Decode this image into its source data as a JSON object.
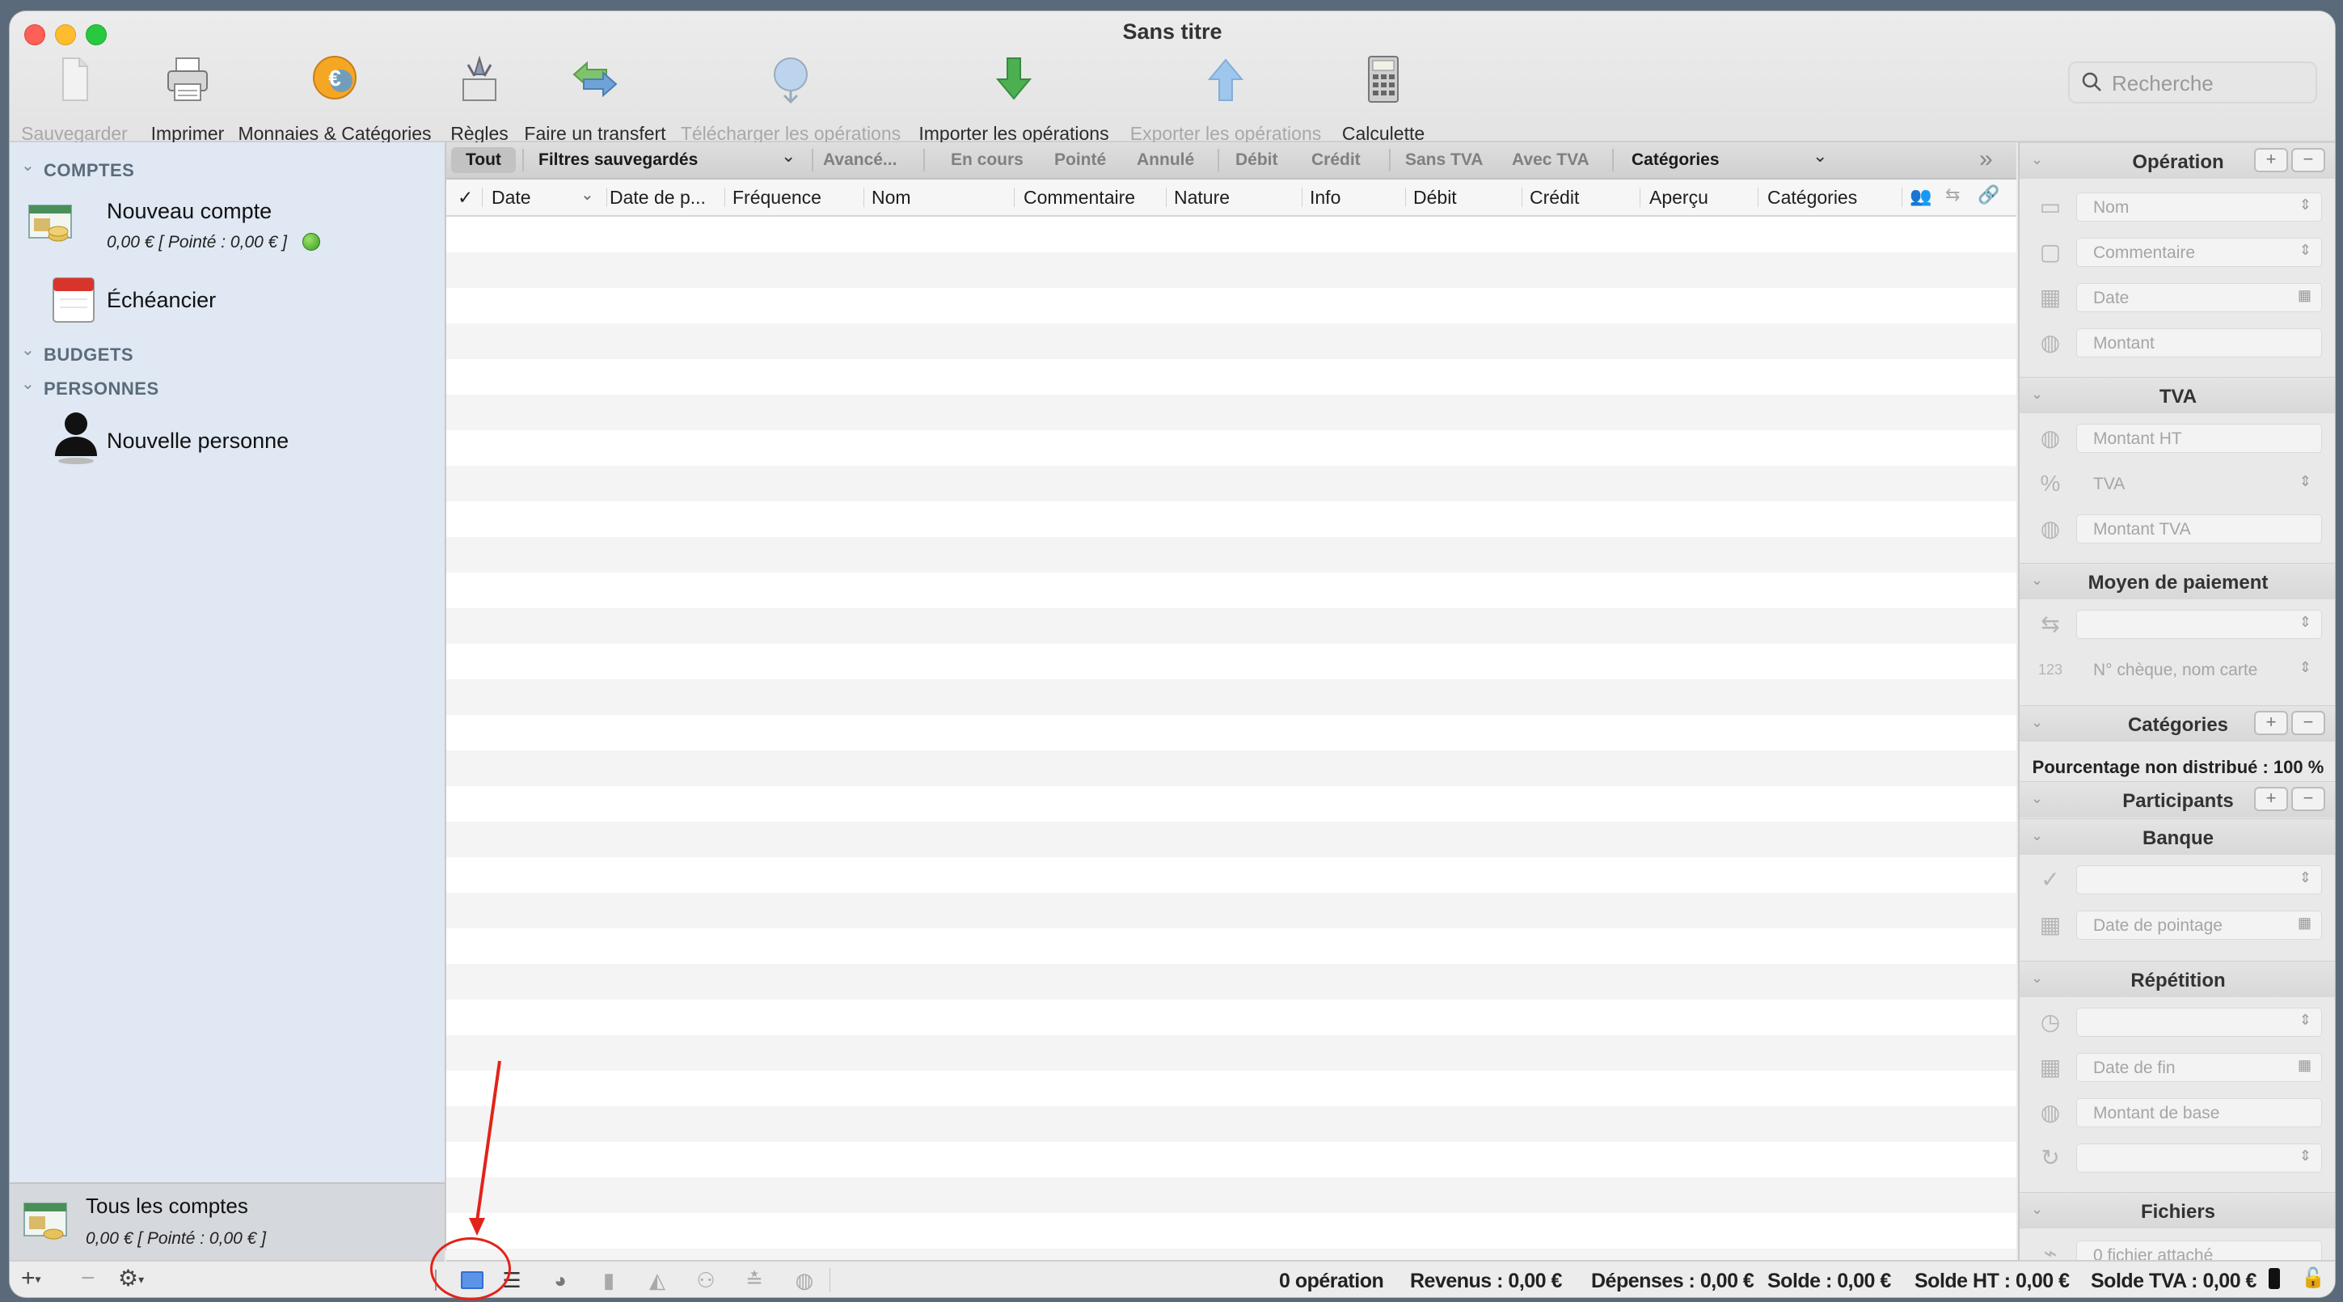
{
  "window": {
    "title": "Sans titre"
  },
  "toolbar": {
    "items": [
      {
        "label": "Sauvegarder",
        "icon": "document-icon",
        "enabled": false
      },
      {
        "label": "Imprimer",
        "icon": "printer-icon",
        "enabled": true
      },
      {
        "label": "Monnaies & Catégories",
        "icon": "euro-coin-icon",
        "enabled": true
      },
      {
        "label": "Règles",
        "icon": "rules-icon",
        "enabled": true
      },
      {
        "label": "Faire un transfert",
        "icon": "transfer-arrows-icon",
        "enabled": true
      },
      {
        "label": "Télécharger les opérations",
        "icon": "globe-download-icon",
        "enabled": false
      },
      {
        "label": "Importer les opérations",
        "icon": "import-arrow-icon",
        "enabled": true
      },
      {
        "label": "Exporter les opérations",
        "icon": "export-arrow-icon",
        "enabled": false
      },
      {
        "label": "Calculette",
        "icon": "calculator-icon",
        "enabled": true
      }
    ],
    "search_placeholder": "Recherche"
  },
  "sidebar": {
    "comptes_label": "COMPTES",
    "account_name": "Nouveau compte",
    "account_balance": "0,00 € [ Pointé : 0,00 € ]",
    "echeancier": "Échéancier",
    "budgets_label": "BUDGETS",
    "personnes_label": "PERSONNES",
    "person": "Nouvelle personne",
    "all_accounts": "Tous les comptes",
    "all_balance": "0,00 € [ Pointé : 0,00 € ]"
  },
  "filters": {
    "tout": "Tout",
    "saved": "Filtres sauvegardés",
    "advanced": "Avancé...",
    "en_cours": "En cours",
    "pointe": "Pointé",
    "annule": "Annulé",
    "debit": "Débit",
    "credit": "Crédit",
    "sans_tva": "Sans TVA",
    "avec_tva": "Avec TVA",
    "categories": "Catégories"
  },
  "columns": {
    "check": "✓",
    "date": "Date",
    "date_p": "Date de p...",
    "frequence": "Fréquence",
    "nom": "Nom",
    "commentaire": "Commentaire",
    "nature": "Nature",
    "info": "Info",
    "debit": "Débit",
    "credit": "Crédit",
    "apercu": "Aperçu",
    "categories": "Catégories"
  },
  "inspector": {
    "operation": "Opération",
    "nom": "Nom",
    "commentaire": "Commentaire",
    "date": "Date",
    "montant": "Montant",
    "tva": "TVA",
    "montant_ht": "Montant HT",
    "tva_field": "TVA",
    "montant_tva": "Montant TVA",
    "moyen_paiement": "Moyen de paiement",
    "cheque": "N° chèque, nom carte",
    "categories": "Catégories",
    "pourcentage": "Pourcentage non distribué : 100 %",
    "participants": "Participants",
    "banque": "Banque",
    "date_pointage": "Date de pointage",
    "repetition": "Répétition",
    "date_fin": "Date de fin",
    "montant_base": "Montant de base",
    "fichiers": "Fichiers",
    "fichier_attache": "0 fichier attaché"
  },
  "status": {
    "operations": "0 opération",
    "revenus": "Revenus : 0,00 €",
    "depenses": "Dépenses : 0,00 €",
    "solde": "Solde : 0,00 €",
    "solde_ht": "Solde HT : 0,00 €",
    "solde_tva": "Solde TVA : 0,00 €"
  },
  "colors": {
    "annotation": "#e2231a",
    "sidebar_bg": "#dfe8f3"
  }
}
